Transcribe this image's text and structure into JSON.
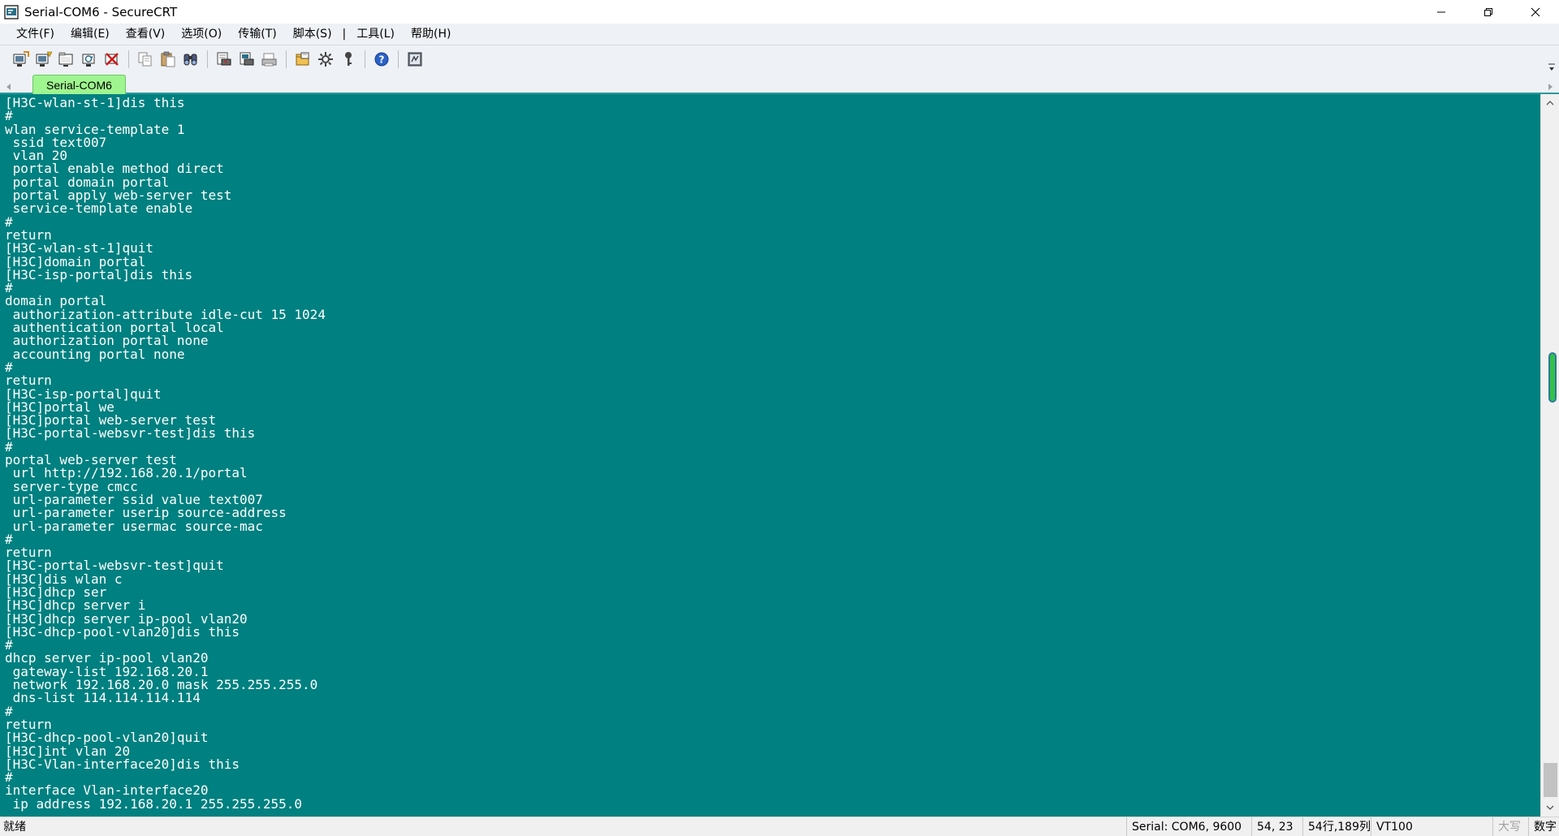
{
  "window": {
    "title": "Serial-COM6 - SecureCRT",
    "controls": {
      "minimize": "minimize-icon",
      "restore": "restore-icon",
      "close": "close-icon"
    }
  },
  "menu": {
    "items": [
      "文件(F)",
      "编辑(E)",
      "查看(V)",
      "选项(O)",
      "传输(T)",
      "脚本(S)",
      "|",
      "工具(L)",
      "帮助(H)"
    ]
  },
  "toolbar": {
    "buttons": [
      "connect-icon",
      "quick-connect-icon",
      "connect-tab-icon",
      "reconnect-icon",
      "disconnect-icon",
      "copy-icon",
      "paste-icon",
      "find-icon",
      "print-icon",
      "print-selection-icon",
      "print-setup-icon",
      "session-options-icon",
      "global-options-icon",
      "keymap-icon",
      "help-icon",
      "sftp-icon"
    ]
  },
  "tabs": [
    {
      "label": "Serial-COM6",
      "active": true
    }
  ],
  "terminal": {
    "background": "#008080",
    "foreground": "#ffffff",
    "lines": [
      "[H3C-wlan-st-1]dis this",
      "#",
      "wlan service-template 1",
      " ssid text007",
      " vlan 20",
      " portal enable method direct",
      " portal domain portal",
      " portal apply web-server test",
      " service-template enable",
      "#",
      "return",
      "[H3C-wlan-st-1]quit",
      "[H3C]domain portal",
      "[H3C-isp-portal]dis this",
      "#",
      "domain portal",
      " authorization-attribute idle-cut 15 1024",
      " authentication portal local",
      " authorization portal none",
      " accounting portal none",
      "#",
      "return",
      "[H3C-isp-portal]quit",
      "[H3C]portal we",
      "[H3C]portal web-server test",
      "[H3C-portal-websvr-test]dis this",
      "#",
      "portal web-server test",
      " url http://192.168.20.1/portal",
      " server-type cmcc",
      " url-parameter ssid value text007",
      " url-parameter userip source-address",
      " url-parameter usermac source-mac",
      "#",
      "return",
      "[H3C-portal-websvr-test]quit",
      "[H3C]dis wlan c",
      "[H3C]dhcp ser",
      "[H3C]dhcp server i",
      "[H3C]dhcp server ip-pool vlan20",
      "[H3C-dhcp-pool-vlan20]dis this",
      "#",
      "dhcp server ip-pool vlan20",
      " gateway-list 192.168.20.1",
      " network 192.168.20.0 mask 255.255.255.0",
      " dns-list 114.114.114.114",
      "#",
      "return",
      "[H3C-dhcp-pool-vlan20]quit",
      "[H3C]int vlan 20",
      "[H3C-Vlan-interface20]dis this",
      "#",
      "interface Vlan-interface20",
      " ip address 192.168.20.1 255.255.255.0"
    ]
  },
  "statusbar": {
    "ready": "就绪",
    "serial": "Serial: COM6, 9600",
    "position": "54, 23",
    "rowcol": "54行,189列",
    "terminal_type": "VT100",
    "caps": "大写",
    "num": "数字"
  }
}
